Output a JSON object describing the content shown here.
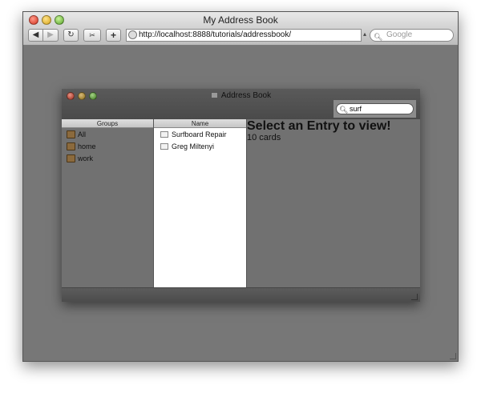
{
  "browser": {
    "title": "My Address Book",
    "back_icon": "◀",
    "forward_icon": "▶",
    "reload_icon": "↻",
    "snip_icon": "✂",
    "add_icon": "+",
    "url": "http://localhost:8888/tutorials/addressbook/",
    "search_placeholder": "Google"
  },
  "address_book": {
    "title": "Address Book",
    "search_value": "surf",
    "groups_header": "Groups",
    "names_header": "Name",
    "groups": [
      {
        "label": "All"
      },
      {
        "label": "home"
      },
      {
        "label": "work"
      }
    ],
    "names": [
      {
        "label": "Surfboard Repair"
      },
      {
        "label": "Greg Miltenyi"
      }
    ],
    "detail_title": "Select an Entry to view!",
    "detail_count": "10 cards"
  }
}
